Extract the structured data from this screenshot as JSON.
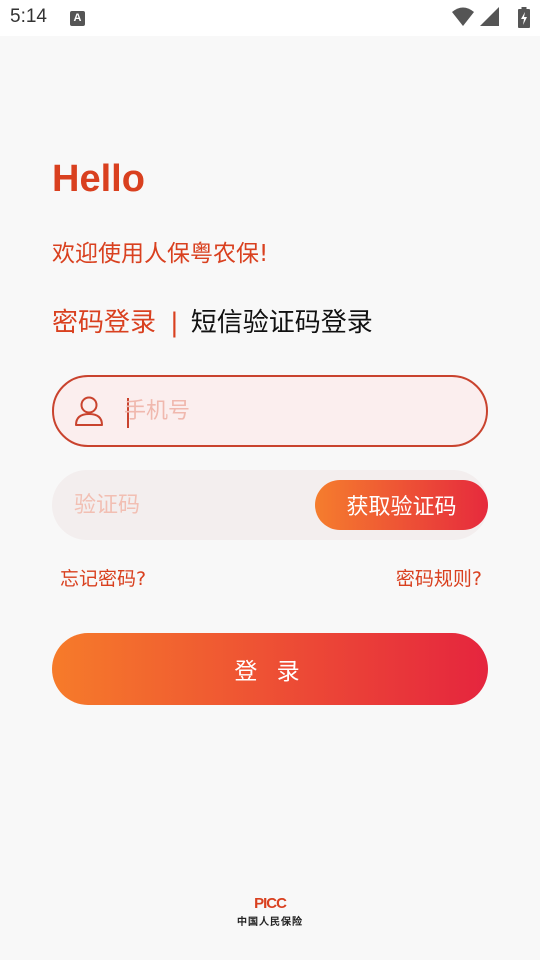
{
  "status_bar": {
    "time": "5:14",
    "notification_icon_text": "A",
    "icons": [
      "wifi-icon",
      "signal-icon",
      "battery-charging-icon"
    ]
  },
  "greeting": {
    "title": "Hello",
    "subtitle": "欢迎使用人保粤农保!"
  },
  "tabs": {
    "password_login": "密码登录",
    "divider": "|",
    "sms_login": "短信验证码登录"
  },
  "phone_field": {
    "placeholder": "手机号",
    "value": "",
    "icon": "user-icon"
  },
  "code_field": {
    "placeholder": "验证码",
    "value": "",
    "get_code_label": "获取验证码"
  },
  "links": {
    "forgot_password": "忘记密码?",
    "password_rules": "密码规则?"
  },
  "login_button": {
    "label": "登 录"
  },
  "footer": {
    "logo_mark": "PICC",
    "logo_text": "中国人民保险"
  },
  "colors": {
    "accent": "#d9401f",
    "gradient_start": "#f67b2a",
    "gradient_end": "#e5253e",
    "background": "#f8f8f8"
  }
}
